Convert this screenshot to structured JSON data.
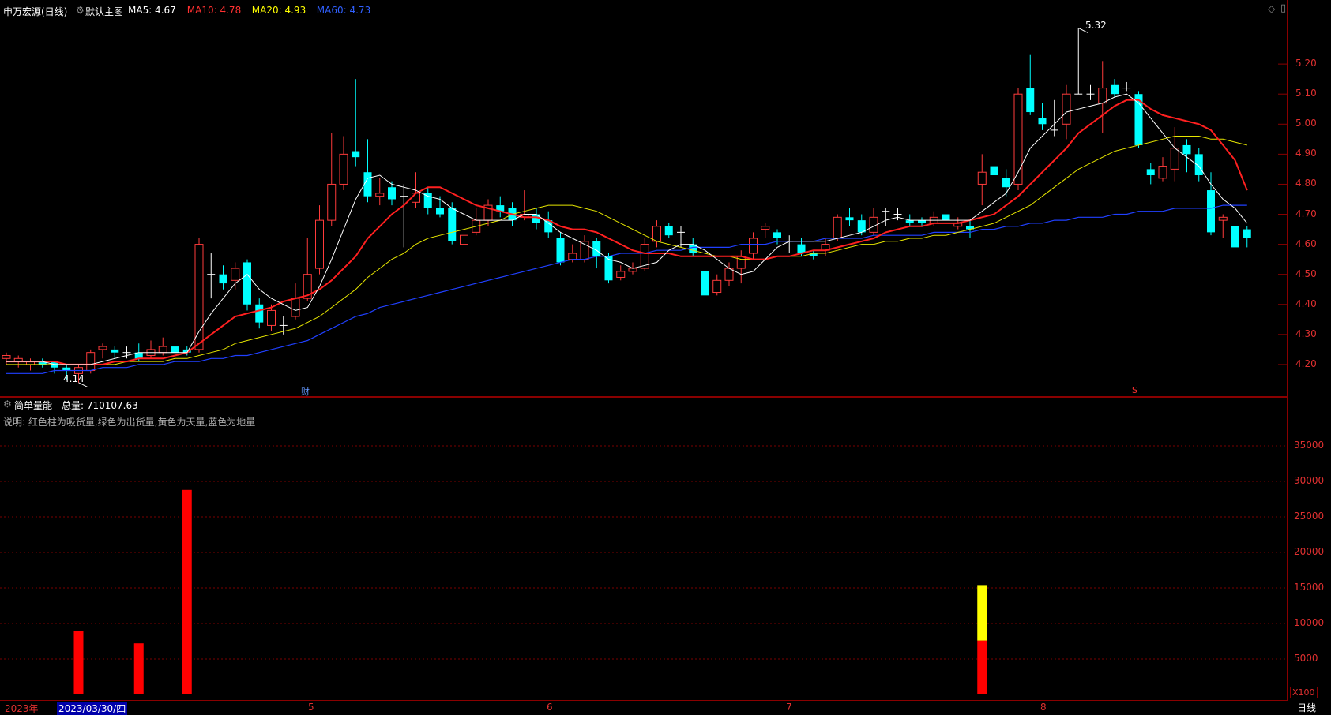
{
  "header": {
    "stock": "申万宏源(日线)",
    "template": "默认主图",
    "ma": [
      {
        "label": "MA5: 4.67",
        "color": "#ffffff"
      },
      {
        "label": "MA10: 4.78",
        "color": "#ff3030"
      },
      {
        "label": "MA20: 4.93",
        "color": "#ffff00"
      },
      {
        "label": "MA60: 4.73",
        "color": "#3060ff"
      }
    ]
  },
  "price_axis": [
    "5.20",
    "5.10",
    "5.00",
    "4.90",
    "4.80",
    "4.70",
    "4.60",
    "4.50",
    "4.40",
    "4.30",
    "4.20"
  ],
  "markers": {
    "high": "5.32",
    "low": "4.14",
    "cai": "财",
    "s": "S"
  },
  "volume_panel": {
    "title": "简单量能",
    "total": "总量: 710107.63",
    "note": "说明: 红色柱为吸货量,绿色为出货量,黄色为天量,蓝色为地量",
    "axis": [
      "35000",
      "30000",
      "25000",
      "20000",
      "15000",
      "10000",
      "5000"
    ],
    "unit": "X100"
  },
  "time_axis": {
    "year": "2023年",
    "cursor_date": "2023/03/30/四",
    "months": [
      "5",
      "6",
      "7",
      "8"
    ],
    "period_button": "日线"
  },
  "chart_data": {
    "type": "candlestick",
    "x_unit": "trading day",
    "ylim": [
      4.1,
      5.35
    ],
    "candles": [
      [
        4.22,
        4.23,
        4.24,
        4.2
      ],
      [
        4.21,
        4.22,
        4.23,
        4.19
      ],
      [
        4.2,
        4.21,
        4.22,
        4.18
      ],
      [
        4.21,
        4.2,
        4.22,
        4.19
      ],
      [
        4.21,
        4.19,
        4.21,
        4.17
      ],
      [
        4.19,
        4.18,
        4.2,
        4.15
      ],
      [
        4.17,
        4.19,
        4.2,
        4.14
      ],
      [
        4.18,
        4.24,
        4.25,
        4.17
      ],
      [
        4.25,
        4.26,
        4.27,
        4.22
      ],
      [
        4.25,
        4.24,
        4.26,
        4.22
      ],
      [
        4.24,
        4.24,
        4.26,
        4.22
      ],
      [
        4.24,
        4.22,
        4.27,
        4.21
      ],
      [
        4.23,
        4.25,
        4.28,
        4.22
      ],
      [
        4.24,
        4.26,
        4.29,
        4.23
      ],
      [
        4.26,
        4.24,
        4.28,
        4.23
      ],
      [
        4.25,
        4.24,
        4.26,
        4.23
      ],
      [
        4.25,
        4.6,
        4.62,
        4.24
      ],
      [
        4.5,
        4.5,
        4.57,
        4.42
      ],
      [
        4.5,
        4.47,
        4.53,
        4.45
      ],
      [
        4.48,
        4.52,
        4.54,
        4.45
      ],
      [
        4.54,
        4.4,
        4.55,
        4.38
      ],
      [
        4.4,
        4.34,
        4.42,
        4.32
      ],
      [
        4.33,
        4.38,
        4.4,
        4.31
      ],
      [
        4.33,
        4.33,
        4.36,
        4.3
      ],
      [
        4.36,
        4.42,
        4.47,
        4.35
      ],
      [
        4.42,
        4.5,
        4.62,
        4.41
      ],
      [
        4.52,
        4.68,
        4.73,
        4.5
      ],
      [
        4.68,
        4.8,
        4.97,
        4.66
      ],
      [
        4.8,
        4.9,
        4.96,
        4.78
      ],
      [
        4.91,
        4.89,
        5.15,
        4.86
      ],
      [
        4.84,
        4.76,
        4.95,
        4.74
      ],
      [
        4.76,
        4.77,
        4.82,
        4.73
      ],
      [
        4.79,
        4.75,
        4.81,
        4.73
      ],
      [
        4.76,
        4.76,
        4.8,
        4.59
      ],
      [
        4.74,
        4.77,
        4.84,
        4.72
      ],
      [
        4.77,
        4.72,
        4.79,
        4.7
      ],
      [
        4.72,
        4.7,
        4.76,
        4.69
      ],
      [
        4.72,
        4.61,
        4.74,
        4.6
      ],
      [
        4.6,
        4.63,
        4.67,
        4.58
      ],
      [
        4.64,
        4.68,
        4.72,
        4.63
      ],
      [
        4.68,
        4.73,
        4.75,
        4.66
      ],
      [
        4.73,
        4.71,
        4.76,
        4.69
      ],
      [
        4.72,
        4.68,
        4.74,
        4.66
      ],
      [
        4.69,
        4.7,
        4.78,
        4.68
      ],
      [
        4.7,
        4.67,
        4.72,
        4.65
      ],
      [
        4.68,
        4.64,
        4.71,
        4.62
      ],
      [
        4.62,
        4.54,
        4.64,
        4.53
      ],
      [
        4.55,
        4.57,
        4.6,
        4.54
      ],
      [
        4.55,
        4.61,
        4.63,
        4.54
      ],
      [
        4.61,
        4.56,
        4.62,
        4.52
      ],
      [
        4.56,
        4.48,
        4.57,
        4.47
      ],
      [
        4.49,
        4.51,
        4.53,
        4.48
      ],
      [
        4.51,
        4.52,
        4.54,
        4.5
      ],
      [
        4.52,
        4.6,
        4.62,
        4.51
      ],
      [
        4.61,
        4.66,
        4.68,
        4.59
      ],
      [
        4.66,
        4.63,
        4.67,
        4.62
      ],
      [
        4.64,
        4.64,
        4.66,
        4.59
      ],
      [
        4.6,
        4.57,
        4.62,
        4.56
      ],
      [
        4.51,
        4.43,
        4.52,
        4.42
      ],
      [
        4.44,
        4.48,
        4.5,
        4.43
      ],
      [
        4.48,
        4.52,
        4.54,
        4.46
      ],
      [
        4.52,
        4.56,
        4.58,
        4.47
      ],
      [
        4.57,
        4.62,
        4.64,
        4.55
      ],
      [
        4.65,
        4.66,
        4.67,
        4.62
      ],
      [
        4.64,
        4.62,
        4.65,
        4.6
      ],
      [
        4.61,
        4.61,
        4.63,
        4.57
      ],
      [
        4.6,
        4.57,
        4.62,
        4.56
      ],
      [
        4.57,
        4.56,
        4.58,
        4.55
      ],
      [
        4.58,
        4.6,
        4.62,
        4.56
      ],
      [
        4.62,
        4.69,
        4.7,
        4.61
      ],
      [
        4.69,
        4.68,
        4.72,
        4.66
      ],
      [
        4.68,
        4.64,
        4.7,
        4.63
      ],
      [
        4.64,
        4.69,
        4.72,
        4.63
      ],
      [
        4.71,
        4.71,
        4.72,
        4.66
      ],
      [
        4.7,
        4.7,
        4.72,
        4.68
      ],
      [
        4.68,
        4.67,
        4.7,
        4.66
      ],
      [
        4.68,
        4.67,
        4.69,
        4.66
      ],
      [
        4.67,
        4.69,
        4.71,
        4.66
      ],
      [
        4.7,
        4.68,
        4.71,
        4.65
      ],
      [
        4.66,
        4.67,
        4.69,
        4.65
      ],
      [
        4.66,
        4.65,
        4.68,
        4.62
      ],
      [
        4.8,
        4.84,
        4.9,
        4.73
      ],
      [
        4.86,
        4.83,
        4.92,
        4.8
      ],
      [
        4.82,
        4.79,
        4.85,
        4.76
      ],
      [
        4.8,
        5.1,
        5.12,
        4.78
      ],
      [
        5.12,
        5.04,
        5.23,
        5.03
      ],
      [
        5.02,
        5.0,
        5.07,
        4.98
      ],
      [
        4.98,
        4.98,
        5.08,
        4.96
      ],
      [
        5.0,
        5.1,
        5.13,
        4.95
      ],
      [
        5.1,
        5.1,
        5.32,
        5.1
      ],
      [
        5.1,
        5.1,
        5.13,
        5.08
      ],
      [
        5.07,
        5.12,
        5.21,
        4.97
      ],
      [
        5.13,
        5.1,
        5.15,
        5.09
      ],
      [
        5.12,
        5.12,
        5.14,
        5.11
      ],
      [
        5.1,
        4.93,
        5.11,
        4.92
      ],
      [
        4.85,
        4.83,
        4.87,
        4.8
      ],
      [
        4.82,
        4.86,
        4.89,
        4.81
      ],
      [
        4.85,
        4.92,
        4.99,
        4.81
      ],
      [
        4.93,
        4.9,
        4.95,
        4.84
      ],
      [
        4.9,
        4.83,
        4.92,
        4.81
      ],
      [
        4.78,
        4.64,
        4.84,
        4.63
      ],
      [
        4.68,
        4.69,
        4.7,
        4.62
      ],
      [
        4.66,
        4.59,
        4.68,
        4.58
      ],
      [
        4.65,
        4.62,
        4.66,
        4.59
      ]
    ],
    "ma5": [
      4.21,
      4.21,
      4.21,
      4.21,
      4.2,
      4.2,
      4.2,
      4.2,
      4.21,
      4.22,
      4.23,
      4.24,
      4.24,
      4.24,
      4.24,
      4.24,
      4.31,
      4.37,
      4.42,
      4.47,
      4.5,
      4.45,
      4.42,
      4.4,
      4.38,
      4.39,
      4.46,
      4.55,
      4.65,
      4.75,
      4.82,
      4.83,
      4.8,
      4.79,
      4.78,
      4.76,
      4.75,
      4.72,
      4.7,
      4.68,
      4.68,
      4.68,
      4.68,
      4.7,
      4.7,
      4.67,
      4.64,
      4.62,
      4.6,
      4.58,
      4.55,
      4.54,
      4.52,
      4.53,
      4.54,
      4.58,
      4.6,
      4.6,
      4.58,
      4.55,
      4.52,
      4.5,
      4.51,
      4.55,
      4.59,
      4.61,
      4.61,
      4.61,
      4.61,
      4.62,
      4.63,
      4.64,
      4.66,
      4.68,
      4.69,
      4.68,
      4.68,
      4.68,
      4.68,
      4.68,
      4.68,
      4.71,
      4.74,
      4.77,
      4.84,
      4.92,
      4.96,
      5.0,
      5.04,
      5.05,
      5.06,
      5.07,
      5.09,
      5.1,
      5.07,
      5.02,
      4.97,
      4.92,
      4.89,
      4.86,
      4.8,
      4.75,
      4.72,
      4.67
    ],
    "ma10": [
      4.21,
      4.21,
      4.21,
      4.21,
      4.21,
      4.2,
      4.2,
      4.2,
      4.2,
      4.21,
      4.21,
      4.22,
      4.22,
      4.22,
      4.23,
      4.24,
      4.27,
      4.3,
      4.33,
      4.36,
      4.37,
      4.38,
      4.39,
      4.41,
      4.42,
      4.43,
      4.45,
      4.48,
      4.52,
      4.56,
      4.62,
      4.66,
      4.7,
      4.73,
      4.77,
      4.79,
      4.79,
      4.77,
      4.75,
      4.73,
      4.72,
      4.71,
      4.7,
      4.69,
      4.69,
      4.68,
      4.66,
      4.65,
      4.65,
      4.64,
      4.62,
      4.6,
      4.58,
      4.57,
      4.57,
      4.57,
      4.56,
      4.56,
      4.56,
      4.56,
      4.56,
      4.56,
      4.55,
      4.55,
      4.56,
      4.56,
      4.57,
      4.58,
      4.58,
      4.59,
      4.6,
      4.61,
      4.62,
      4.64,
      4.65,
      4.66,
      4.66,
      4.67,
      4.67,
      4.67,
      4.68,
      4.69,
      4.7,
      4.73,
      4.76,
      4.8,
      4.84,
      4.88,
      4.92,
      4.97,
      5.0,
      5.03,
      5.06,
      5.08,
      5.08,
      5.05,
      5.03,
      5.02,
      5.01,
      5.0,
      4.98,
      4.93,
      4.88,
      4.78
    ],
    "ma20": [
      4.2,
      4.2,
      4.2,
      4.2,
      4.2,
      4.2,
      4.2,
      4.2,
      4.2,
      4.2,
      4.21,
      4.21,
      4.21,
      4.21,
      4.22,
      4.22,
      4.23,
      4.24,
      4.25,
      4.27,
      4.28,
      4.29,
      4.3,
      4.31,
      4.32,
      4.34,
      4.36,
      4.39,
      4.42,
      4.45,
      4.49,
      4.52,
      4.55,
      4.57,
      4.6,
      4.62,
      4.63,
      4.64,
      4.65,
      4.66,
      4.67,
      4.68,
      4.7,
      4.71,
      4.72,
      4.73,
      4.73,
      4.73,
      4.72,
      4.71,
      4.69,
      4.67,
      4.65,
      4.63,
      4.61,
      4.6,
      4.59,
      4.58,
      4.57,
      4.56,
      4.56,
      4.55,
      4.55,
      4.55,
      4.56,
      4.56,
      4.56,
      4.57,
      4.57,
      4.58,
      4.59,
      4.6,
      4.6,
      4.61,
      4.61,
      4.62,
      4.62,
      4.63,
      4.63,
      4.64,
      4.65,
      4.66,
      4.67,
      4.69,
      4.71,
      4.73,
      4.76,
      4.79,
      4.82,
      4.85,
      4.87,
      4.89,
      4.91,
      4.92,
      4.93,
      4.94,
      4.95,
      4.96,
      4.96,
      4.96,
      4.95,
      4.95,
      4.94,
      4.93
    ],
    "ma60": [
      4.17,
      4.17,
      4.17,
      4.17,
      4.18,
      4.18,
      4.18,
      4.18,
      4.19,
      4.19,
      4.19,
      4.2,
      4.2,
      4.2,
      4.21,
      4.21,
      4.21,
      4.22,
      4.22,
      4.23,
      4.23,
      4.24,
      4.25,
      4.26,
      4.27,
      4.28,
      4.3,
      4.32,
      4.34,
      4.36,
      4.37,
      4.39,
      4.4,
      4.41,
      4.42,
      4.43,
      4.44,
      4.45,
      4.46,
      4.47,
      4.48,
      4.49,
      4.5,
      4.51,
      4.52,
      4.53,
      4.54,
      4.55,
      4.55,
      4.56,
      4.56,
      4.57,
      4.57,
      4.57,
      4.58,
      4.58,
      4.58,
      4.59,
      4.59,
      4.59,
      4.59,
      4.6,
      4.6,
      4.6,
      4.61,
      4.61,
      4.61,
      4.61,
      4.62,
      4.62,
      4.62,
      4.62,
      4.63,
      4.63,
      4.63,
      4.63,
      4.63,
      4.64,
      4.64,
      4.64,
      4.64,
      4.65,
      4.65,
      4.66,
      4.66,
      4.67,
      4.67,
      4.68,
      4.68,
      4.69,
      4.69,
      4.69,
      4.7,
      4.7,
      4.71,
      4.71,
      4.71,
      4.72,
      4.72,
      4.72,
      4.72,
      4.73,
      4.73,
      4.73
    ],
    "volume": {
      "ylim": [
        0,
        40000
      ],
      "bars": [
        {
          "index": 6,
          "value": 9000,
          "color": "#ff0000"
        },
        {
          "index": 11,
          "value": 7200,
          "color": "#ff0000"
        },
        {
          "index": 15,
          "value": 28800,
          "color": "#ff0000"
        },
        {
          "index": 81,
          "value": 7600,
          "color": "#ff0000",
          "top_value": 15400,
          "top_color": "#ffff00"
        }
      ]
    }
  }
}
